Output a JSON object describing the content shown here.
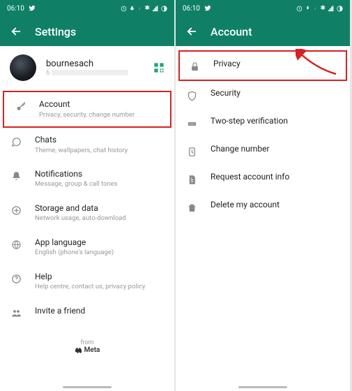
{
  "status": {
    "time": "06:10",
    "icons_left": [
      "twitter-icon"
    ],
    "icons_right": "⏰ 🎤 ⚡ ✱ 📶 ◑"
  },
  "left": {
    "title": "Settings",
    "profile": {
      "name": "bournesach",
      "sub": "6"
    },
    "items": [
      {
        "label": "Account",
        "sub": "Privacy, security, change number",
        "icon": "key-icon"
      },
      {
        "label": "Chats",
        "sub": "Theme, wallpapers, chat history",
        "icon": "chat-icon"
      },
      {
        "label": "Notifications",
        "sub": "Message, group & call tones",
        "icon": "bell-icon"
      },
      {
        "label": "Storage and data",
        "sub": "Network usage, auto-download",
        "icon": "data-icon"
      },
      {
        "label": "App language",
        "sub": "English (phone's language)",
        "icon": "globe-icon"
      },
      {
        "label": "Help",
        "sub": "Help centre, contact us, privacy policy",
        "icon": "help-icon"
      },
      {
        "label": "Invite a friend",
        "sub": "",
        "icon": "people-icon"
      }
    ],
    "footer": {
      "from": "from",
      "brand": "Meta"
    }
  },
  "right": {
    "title": "Account",
    "items": [
      {
        "label": "Privacy",
        "icon": "lock-icon"
      },
      {
        "label": "Security",
        "icon": "shield-icon"
      },
      {
        "label": "Two-step verification",
        "icon": "pin-icon"
      },
      {
        "label": "Change number",
        "icon": "sim-icon"
      },
      {
        "label": "Request account info",
        "icon": "doc-icon"
      },
      {
        "label": "Delete my account",
        "icon": "trash-icon"
      }
    ]
  }
}
